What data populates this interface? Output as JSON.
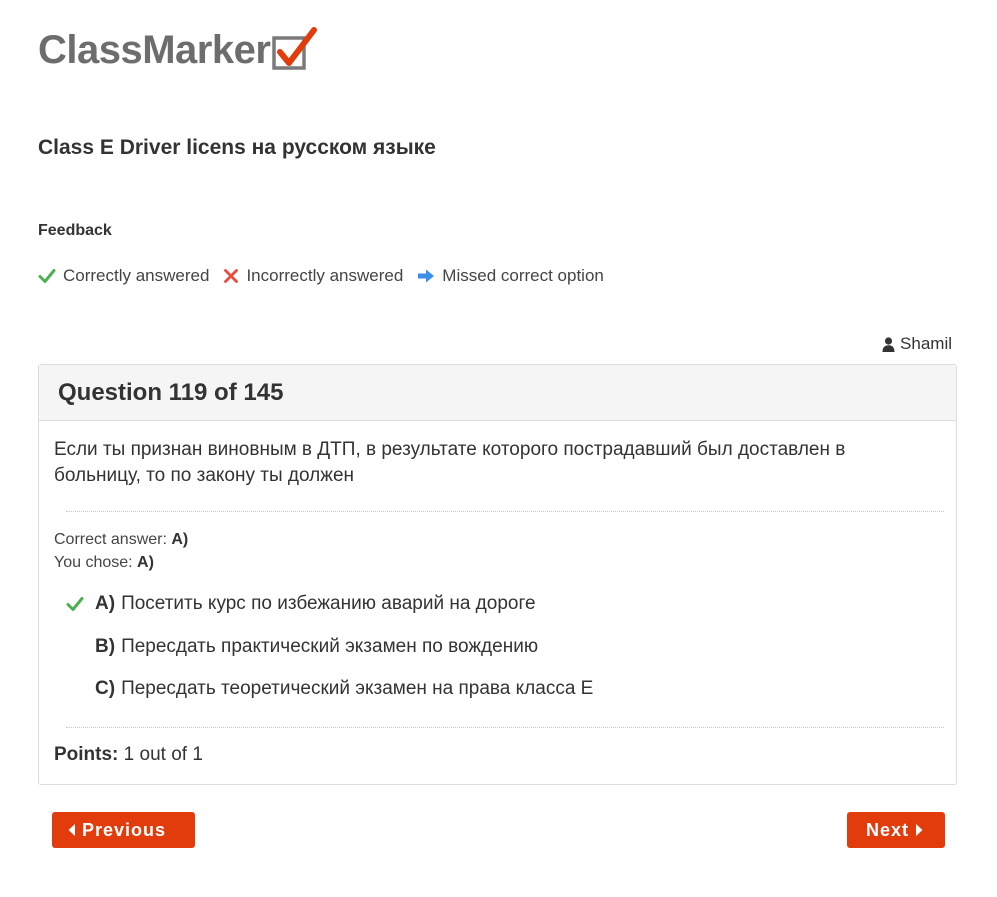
{
  "logo": {
    "text": "ClassMarker"
  },
  "quiz": {
    "title": "Class E Driver licens на русском языке"
  },
  "feedback": {
    "heading": "Feedback",
    "legend": {
      "correct": "Correctly answered",
      "incorrect": "Incorrectly answered",
      "missed": "Missed correct option"
    }
  },
  "user": {
    "name": "Shamil"
  },
  "question": {
    "header": "Question 119 of 145",
    "text": "Если ты признан виновным в ДТП, в результате которого пострадавший был доставлен в больницу, то по закону ты должен",
    "correct_label": "Correct answer:",
    "correct_value": "A)",
    "chose_label": "You chose:",
    "chose_value": "A)",
    "options": [
      {
        "letter": "A)",
        "text": "Посетить курс по избежанию аварий на дороге",
        "status": "correct"
      },
      {
        "letter": "B)",
        "text": "Пересдать практический экзамен по вождению",
        "status": "none"
      },
      {
        "letter": "C)",
        "text": "Пересдать теоретический экзамен на права класса Е",
        "status": "none"
      }
    ],
    "points_label": "Points:",
    "points_value": "1 out of 1"
  },
  "nav": {
    "previous": "Previous",
    "next": "Next"
  },
  "colors": {
    "brand_red": "#e23c0d",
    "correct_green": "#4caf50",
    "incorrect_red": "#e74c3c",
    "missed_blue": "#3a8fe8"
  }
}
